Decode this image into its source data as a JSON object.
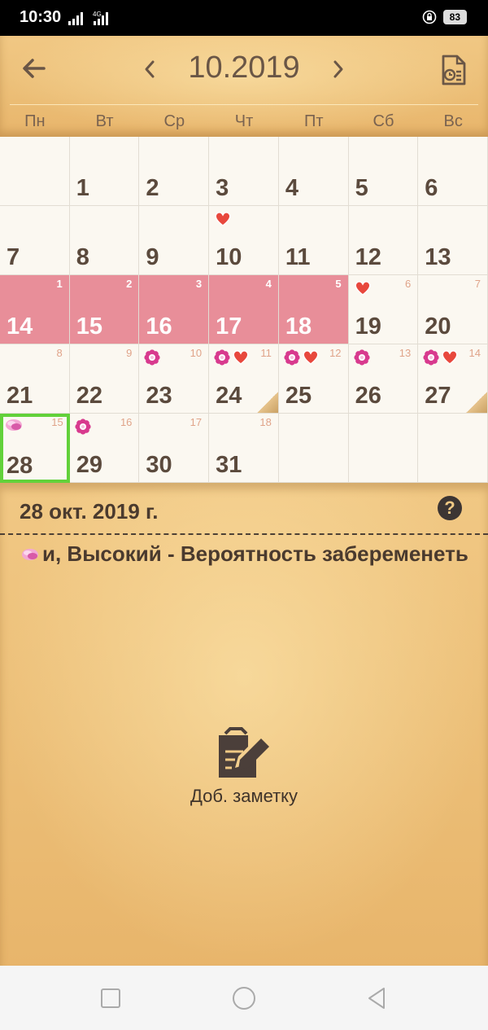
{
  "status_bar": {
    "time": "10:30",
    "network": "4G",
    "battery": "83"
  },
  "header": {
    "month_title": "10.2019",
    "weekdays": [
      "Пн",
      "Вт",
      "Ср",
      "Чт",
      "Пт",
      "Сб",
      "Вс"
    ]
  },
  "calendar": {
    "days": [
      {
        "day": "1"
      },
      {
        "day": "2"
      },
      {
        "day": "3"
      },
      {
        "day": "4"
      },
      {
        "day": "5"
      },
      {
        "day": "6"
      },
      {
        "day": "7"
      },
      {
        "day": "8"
      },
      {
        "day": "9"
      },
      {
        "day": "10",
        "icons": [
          "heart"
        ]
      },
      {
        "day": "11"
      },
      {
        "day": "12"
      },
      {
        "day": "13"
      },
      {
        "day": "14",
        "cycle": "1",
        "period": true
      },
      {
        "day": "15",
        "cycle": "2",
        "period": true
      },
      {
        "day": "16",
        "cycle": "3",
        "period": true
      },
      {
        "day": "17",
        "cycle": "4",
        "period": true
      },
      {
        "day": "18",
        "cycle": "5",
        "period": true
      },
      {
        "day": "19",
        "cycle": "6",
        "icons": [
          "heart"
        ]
      },
      {
        "day": "20",
        "cycle": "7"
      },
      {
        "day": "21",
        "cycle": "8"
      },
      {
        "day": "22",
        "cycle": "9"
      },
      {
        "day": "23",
        "cycle": "10",
        "icons": [
          "flower"
        ]
      },
      {
        "day": "24",
        "cycle": "11",
        "icons": [
          "flower",
          "heart"
        ],
        "note": true
      },
      {
        "day": "25",
        "cycle": "12",
        "icons": [
          "flower",
          "heart"
        ]
      },
      {
        "day": "26",
        "cycle": "13",
        "icons": [
          "flower"
        ]
      },
      {
        "day": "27",
        "cycle": "14",
        "icons": [
          "flower",
          "heart"
        ],
        "note": true
      },
      {
        "day": "28",
        "cycle": "15",
        "icons": [
          "pill"
        ],
        "selected": true
      },
      {
        "day": "29",
        "cycle": "16",
        "icons": [
          "flower"
        ]
      },
      {
        "day": "30",
        "cycle": "17"
      },
      {
        "day": "31",
        "cycle": "18"
      }
    ],
    "first_weekday_offset": 1
  },
  "details": {
    "date_title": "28 окт. 2019 г.",
    "info_text": "и, Высокий - Вероятность забеременеть",
    "add_note_label": "Доб. заметку"
  },
  "colors": {
    "period": "#e88e99",
    "selected_border": "#62d13a",
    "heart": "#e8483d",
    "flower": "#d83a8e"
  }
}
